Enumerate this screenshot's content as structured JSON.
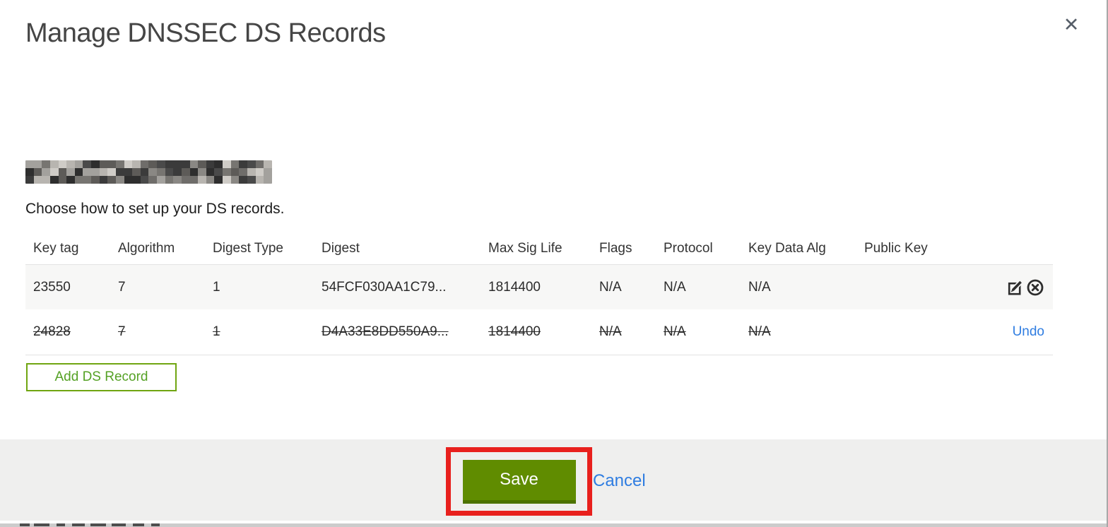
{
  "modal": {
    "title": "Manage DNSSEC DS Records",
    "close_glyph": "✕"
  },
  "instruction": "Choose how to set up your DS records.",
  "table": {
    "columns": [
      "Key tag",
      "Algorithm",
      "Digest Type",
      "Digest",
      "Max Sig Life",
      "Flags",
      "Protocol",
      "Key Data Alg",
      "Public Key"
    ],
    "rows": [
      {
        "state": "active",
        "values": [
          "23550",
          "7",
          "1",
          "54FCF030AA1C79...",
          "1814400",
          "N/A",
          "N/A",
          "N/A",
          ""
        ]
      },
      {
        "state": "deleted",
        "values": [
          "24828",
          "7",
          "1",
          "D4A33E8DD550A9...",
          "1814400",
          "N/A",
          "N/A",
          "N/A",
          ""
        ],
        "action_label": "Undo"
      }
    ]
  },
  "buttons": {
    "add": "Add DS Record",
    "save": "Save",
    "cancel": "Cancel"
  },
  "colors": {
    "accent_green_border": "#70A511",
    "accent_green_text": "#55A125",
    "save_button_green": "#608C00",
    "link_blue": "#2F7DE1",
    "annotation_red": "#E8201D",
    "row_alt_bg": "#F7F7F6",
    "footer_bg": "#EFEFEE"
  },
  "redaction": {
    "domain_redacted": true,
    "cols": 30,
    "rows": 3,
    "palette": [
      "#2e2e2e",
      "#4a4a4a",
      "#5d5b58",
      "#6f6d6a",
      "#8a8884",
      "#a3a19d",
      "#b8b5b0",
      "#cfccc7",
      "#3b3b3b",
      "#777571"
    ]
  }
}
